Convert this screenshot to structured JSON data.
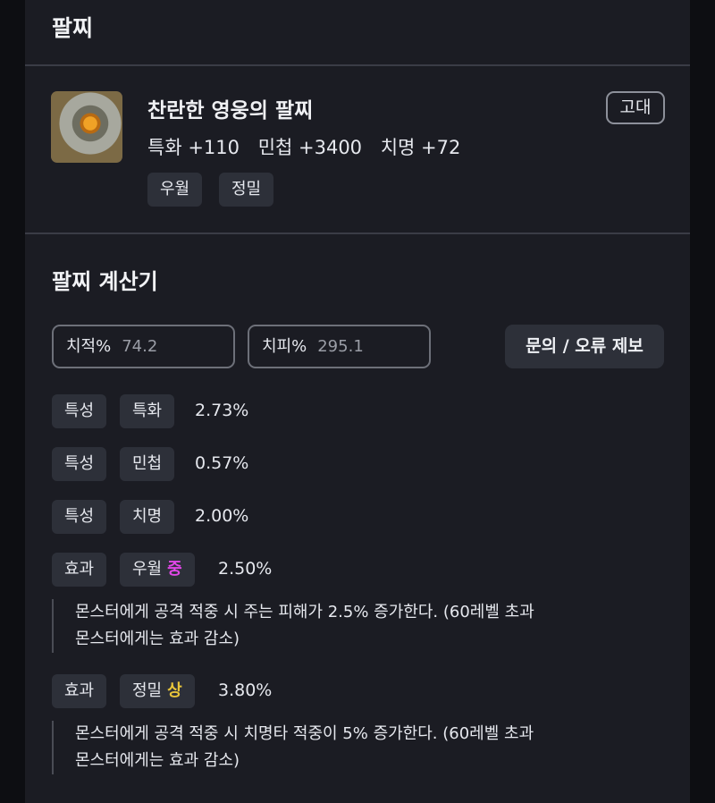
{
  "section": {
    "title": "팔찌"
  },
  "item": {
    "icon": "bracelet-icon",
    "name": "찬란한 영웅의 팔찌",
    "grade": "고대",
    "stats": [
      "특화 +110",
      "민첩 +3400",
      "치명 +72"
    ],
    "tags": [
      "우월",
      "정밀"
    ]
  },
  "calculator": {
    "title": "팔찌 계산기",
    "crit_rate": {
      "label": "치적%",
      "value": "74.2"
    },
    "crit_damage": {
      "label": "치피%",
      "value": "295.1"
    },
    "report_button": "문의 / 오류 제보",
    "rows": [
      {
        "type": "특성",
        "name": "특화",
        "value": "2.73%"
      },
      {
        "type": "특성",
        "name": "민첩",
        "value": "0.57%"
      },
      {
        "type": "특성",
        "name": "치명",
        "value": "2.00%"
      },
      {
        "type": "효과",
        "name": "우월",
        "level": "중",
        "value": "2.50%",
        "desc": [
          "몬스터에게 공격 적중 시 주는 피해가 2.5% 증가한다. (60레벨 초과",
          "몬스터에게는 효과 감소)"
        ]
      },
      {
        "type": "효과",
        "name": "정밀",
        "level": "상",
        "value": "3.80%",
        "desc": [
          "몬스터에게 공격 적중 시 치명타 적중이 5% 증가한다. (60레벨 초과",
          "몬스터에게는 효과 감소)"
        ]
      }
    ]
  },
  "colors": {
    "level_mid": "#e247e8",
    "level_high": "#e8c53a",
    "background": "#1b1c23"
  }
}
